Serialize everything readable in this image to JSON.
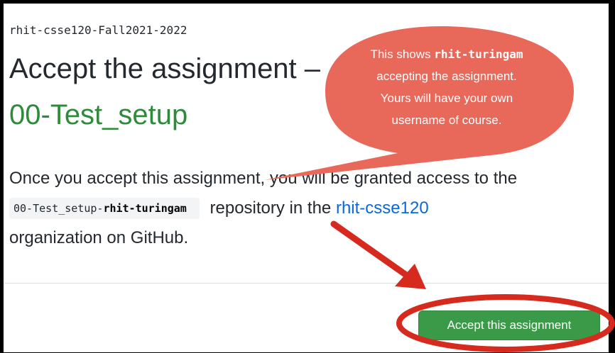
{
  "header": {
    "org_name": "rhit-csse120-Fall2021-2022",
    "title": "Accept the assignment –",
    "assignment_name": "00-Test_setup"
  },
  "body": {
    "line1": "Once you accept this assignment, you will be granted access to the",
    "repo_prefix": "00-Test_setup-",
    "repo_user": "rhit-turingam",
    "repo_suffix": "repository in the",
    "org_link": "rhit-csse120",
    "line3": "organization on GitHub."
  },
  "actions": {
    "accept_label": "Accept this assignment"
  },
  "annotation": {
    "prefix": "This shows",
    "username": "rhit-turingam",
    "line2": "accepting the assignment.",
    "line3": "Yours will have your own",
    "line4": "username of course.",
    "bubble_color": "#e8685a",
    "arrow_color": "#d62a1f"
  }
}
